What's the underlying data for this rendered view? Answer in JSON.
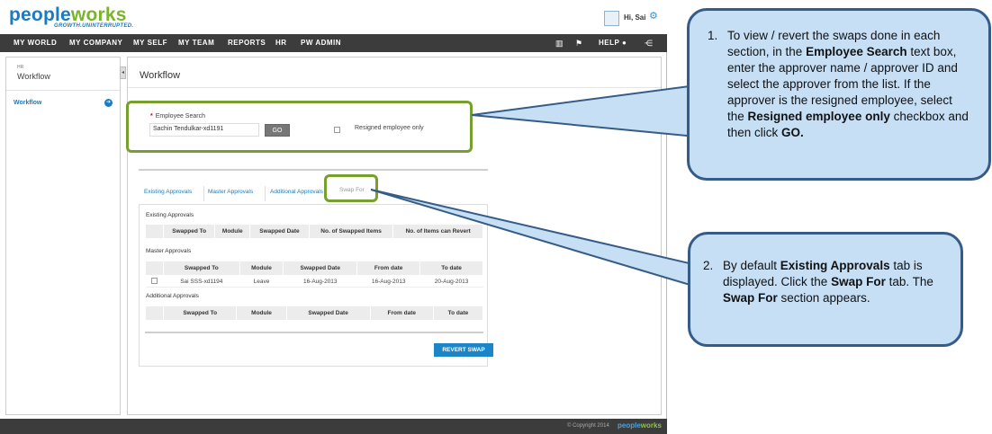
{
  "header": {
    "logo_prefix": "pe",
    "logo_mid": "ople",
    "logo_suffix": "works",
    "tagline": "GROWTH.UNINTERRUPTED.",
    "greeting": "Hi, Sai"
  },
  "nav": {
    "items": [
      "MY WORLD",
      "MY COMPANY",
      "MY SELF",
      "MY TEAM",
      "REPORTS",
      "HR",
      "PW ADMIN"
    ],
    "help_label": "HELP"
  },
  "sidebar": {
    "section": "HR",
    "title": "Workflow",
    "items": [
      {
        "label": "Workflow"
      }
    ]
  },
  "main": {
    "title": "Workflow",
    "search": {
      "label": "Employee Search",
      "required_mark": "*",
      "value": "Sachin Tendulkar-xd1191",
      "go_label": "GO",
      "resigned_label": "Resigned employee only"
    },
    "tabs": [
      {
        "label": "Existing Approvals"
      },
      {
        "label": "Master Approvals"
      },
      {
        "label": "Additional Approvals"
      },
      {
        "label": "Swap For"
      }
    ],
    "existing": {
      "title": "Existing Approvals",
      "columns": [
        "",
        "Swapped To",
        "Module",
        "Swapped Date",
        "No. of Swapped Items",
        "No. of Items can Revert"
      ]
    },
    "master": {
      "title": "Master Approvals",
      "columns": [
        "",
        "Swapped To",
        "Module",
        "Swapped Date",
        "From date",
        "To date"
      ],
      "rows": [
        {
          "swapped_to": "Sai SSS-xd1194",
          "module": "Leave",
          "swapped_date": "16-Aug-2013",
          "from_date": "16-Aug-2013",
          "to_date": "20-Aug-2013"
        }
      ]
    },
    "additional": {
      "title": "Additional Approvals",
      "columns": [
        "",
        "Swapped To",
        "Module",
        "Swapped Date",
        "From date",
        "To date"
      ]
    },
    "revert_label": "REVERT SWAP"
  },
  "footer": {
    "copyright": "© Copyright 2014",
    "logo_prefix": "pe",
    "logo_mid": "ople",
    "logo_suffix": "works"
  },
  "callouts": [
    {
      "number": "1.",
      "parts": [
        {
          "t": "To view / revert the swaps done in each section, in the ",
          "b": false
        },
        {
          "t": "Employee Search",
          "b": true
        },
        {
          "t": " text box, enter the approver name / approver ID and select the approver from the list.  If the approver is the resigned employee, select the ",
          "b": false
        },
        {
          "t": "Resigned employee only",
          "b": true
        },
        {
          "t": " checkbox and then click ",
          "b": false
        },
        {
          "t": "GO.",
          "b": true
        }
      ]
    },
    {
      "number": "2.",
      "parts": [
        {
          "t": "By default ",
          "b": false
        },
        {
          "t": "Existing Approvals",
          "b": true
        },
        {
          "t": " tab is displayed. Click the ",
          "b": false
        },
        {
          "t": "Swap For",
          "b": true
        },
        {
          "t": " tab. The ",
          "b": false
        },
        {
          "t": "Swap For",
          "b": true
        },
        {
          "t": " section appears.",
          "b": false
        }
      ]
    }
  ],
  "colors": {
    "brand_blue": "#1a7bbf",
    "brand_green": "#7ab42c",
    "highlight_green": "#76a02e",
    "callout_fill": "#c6dff5",
    "callout_border": "#355c86"
  }
}
